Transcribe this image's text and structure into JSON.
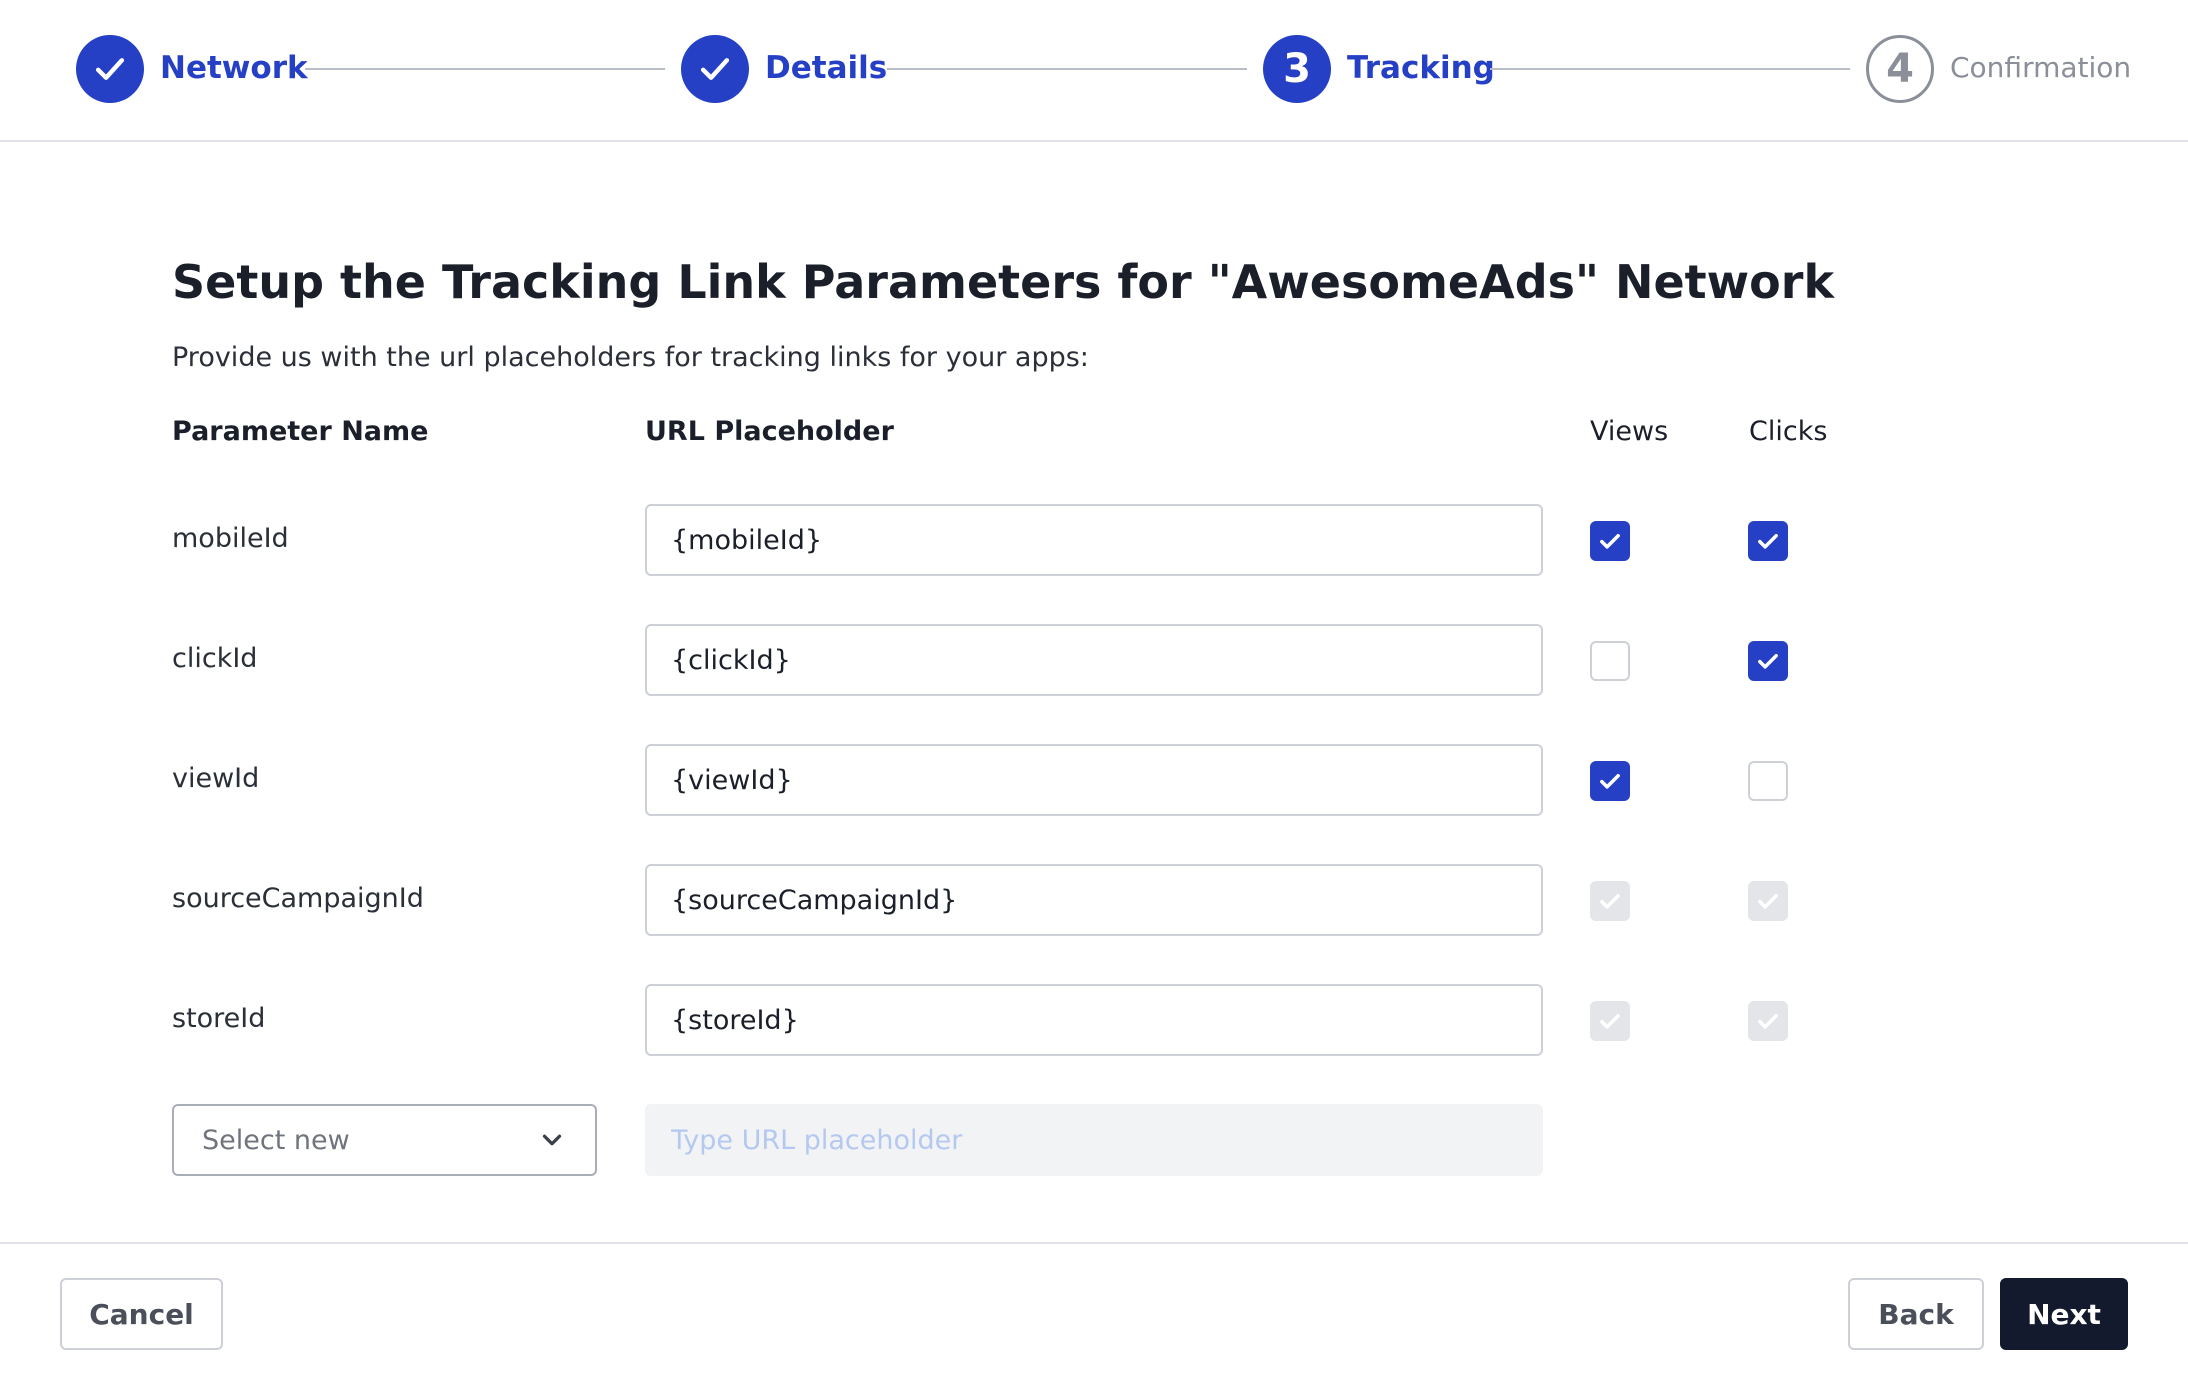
{
  "stepper": {
    "steps": [
      {
        "label": "Network",
        "state": "done",
        "icon": "check-icon"
      },
      {
        "label": "Details",
        "state": "done",
        "icon": "check-icon"
      },
      {
        "label": "Tracking",
        "state": "active",
        "number": "3"
      },
      {
        "label": "Confirmation",
        "state": "pending",
        "number": "4"
      }
    ]
  },
  "main": {
    "title": "Setup the Tracking Link Parameters for \"AwesomeAds\" Network",
    "subtitle": "Provide us with the url placeholders for tracking links for your apps:",
    "columns": {
      "param_name": "Parameter Name",
      "url_placeholder": "URL Placeholder",
      "views": "Views",
      "clicks": "Clicks"
    },
    "rows": [
      {
        "name": "mobileId",
        "placeholder": "{mobileId}",
        "views": "checked",
        "clicks": "checked"
      },
      {
        "name": "clickId",
        "placeholder": "{clickId}",
        "views": "unchecked",
        "clicks": "checked"
      },
      {
        "name": "viewId",
        "placeholder": "{viewId}",
        "views": "checked",
        "clicks": "unchecked"
      },
      {
        "name": "sourceCampaignId",
        "placeholder": "{sourceCampaignId}",
        "views": "disabled-checked",
        "clicks": "disabled-checked"
      },
      {
        "name": "storeId",
        "placeholder": "{storeId}",
        "views": "disabled-checked",
        "clicks": "disabled-checked"
      }
    ],
    "new_row": {
      "select_placeholder": "Select new",
      "url_placeholder": "Type URL placeholder"
    }
  },
  "footer": {
    "cancel_label": "Cancel",
    "back_label": "Back",
    "next_label": "Next"
  },
  "colors": {
    "accent": "#2540c4",
    "primary_button": "#141a2e",
    "muted": "#8a8f99"
  }
}
